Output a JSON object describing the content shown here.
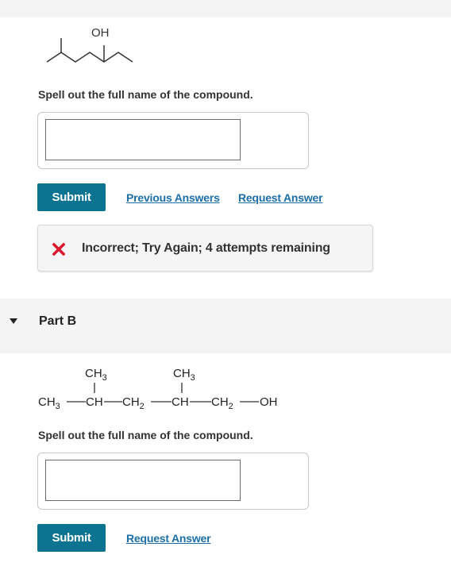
{
  "part_a": {
    "molecule_label": "OH",
    "prompt": "Spell out the full name of the compound.",
    "answer_value": "",
    "submit_label": "Submit",
    "previous_answers_label": "Previous Answers",
    "request_answer_label": "Request Answer",
    "feedback_icon": "x-icon",
    "feedback_text": "Incorrect; Try Again; 4 attempts remaining",
    "error_color": "#d9182d"
  },
  "part_b": {
    "title": "Part B",
    "structure": {
      "branch_1": "CH3",
      "branch_2": "CH3",
      "chain": [
        "CH3",
        "CH",
        "CH2",
        "CH",
        "CH2",
        "OH"
      ]
    },
    "prompt": "Spell out the full name of the compound.",
    "answer_value": "",
    "submit_label": "Submit",
    "request_answer_label": "Request Answer"
  },
  "colors": {
    "accent": "#0c7490",
    "link": "#1b6fa6",
    "section_bg": "#f4f4f4"
  }
}
